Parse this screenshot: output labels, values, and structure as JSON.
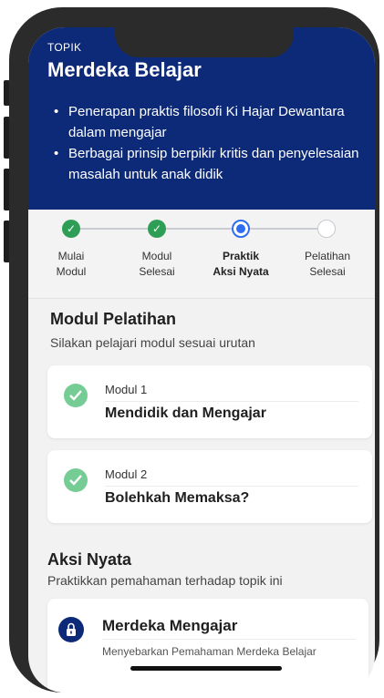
{
  "header": {
    "label": "TOPIK",
    "title": "Merdeka Belajar",
    "bullets": [
      "Penerapan praktis filosofi Ki Hajar Dewantara dalam mengajar",
      "Berbagai prinsip berpikir kritis dan penyelesaian masalah untuk anak didik"
    ]
  },
  "progress": {
    "steps": [
      {
        "line1": "Mulai",
        "line2": "Modul",
        "state": "done"
      },
      {
        "line1": "Modul",
        "line2": "Selesai",
        "state": "done"
      },
      {
        "line1": "Praktik",
        "line2": "Aksi Nyata",
        "state": "active"
      },
      {
        "line1": "Pelatihan",
        "line2": "Selesai",
        "state": "todo"
      }
    ]
  },
  "modules": {
    "title": "Modul Pelatihan",
    "subtitle": "Silakan pelajari modul sesuai urutan",
    "items": [
      {
        "number": "Modul 1",
        "name": "Mendidik dan Mengajar"
      },
      {
        "number": "Modul 2",
        "name": "Bolehkah Memaksa?"
      }
    ]
  },
  "aksi": {
    "title": "Aksi Nyata",
    "subtitle": "Praktikkan pemahaman terhadap topik ini",
    "card": {
      "name": "Merdeka Mengajar",
      "description": "Menyebarkan Pemahaman Merdeka Belajar"
    }
  },
  "colors": {
    "header_bg": "#0d2a78",
    "done_green": "#2e9e57",
    "active_blue": "#2e6df0",
    "check_light_green": "#76cc95"
  }
}
